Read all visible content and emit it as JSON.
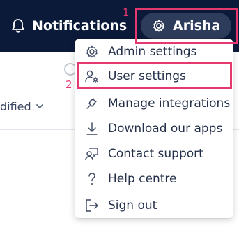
{
  "header": {
    "notifications_label": "Notifications",
    "user_name": "Arisha"
  },
  "toolbar": {
    "sort_label": "dified"
  },
  "menu": {
    "items": [
      {
        "label": "Admin settings",
        "icon": "gear-icon"
      },
      {
        "label": "User settings",
        "icon": "user-settings-icon"
      },
      {
        "label": "Manage integrations",
        "icon": "plug-icon"
      },
      {
        "label": "Download our apps",
        "icon": "download-icon"
      },
      {
        "label": "Contact support",
        "icon": "support-icon"
      },
      {
        "label": "Help centre",
        "icon": "question-icon"
      },
      {
        "label": "Sign out",
        "icon": "sign-out-icon"
      }
    ]
  },
  "annotations": {
    "step1": "1",
    "step2": "2"
  },
  "colors": {
    "header_bg": "#0c1a3a",
    "pill_bg": "#2e3c5b",
    "highlight": "#e5386f"
  }
}
